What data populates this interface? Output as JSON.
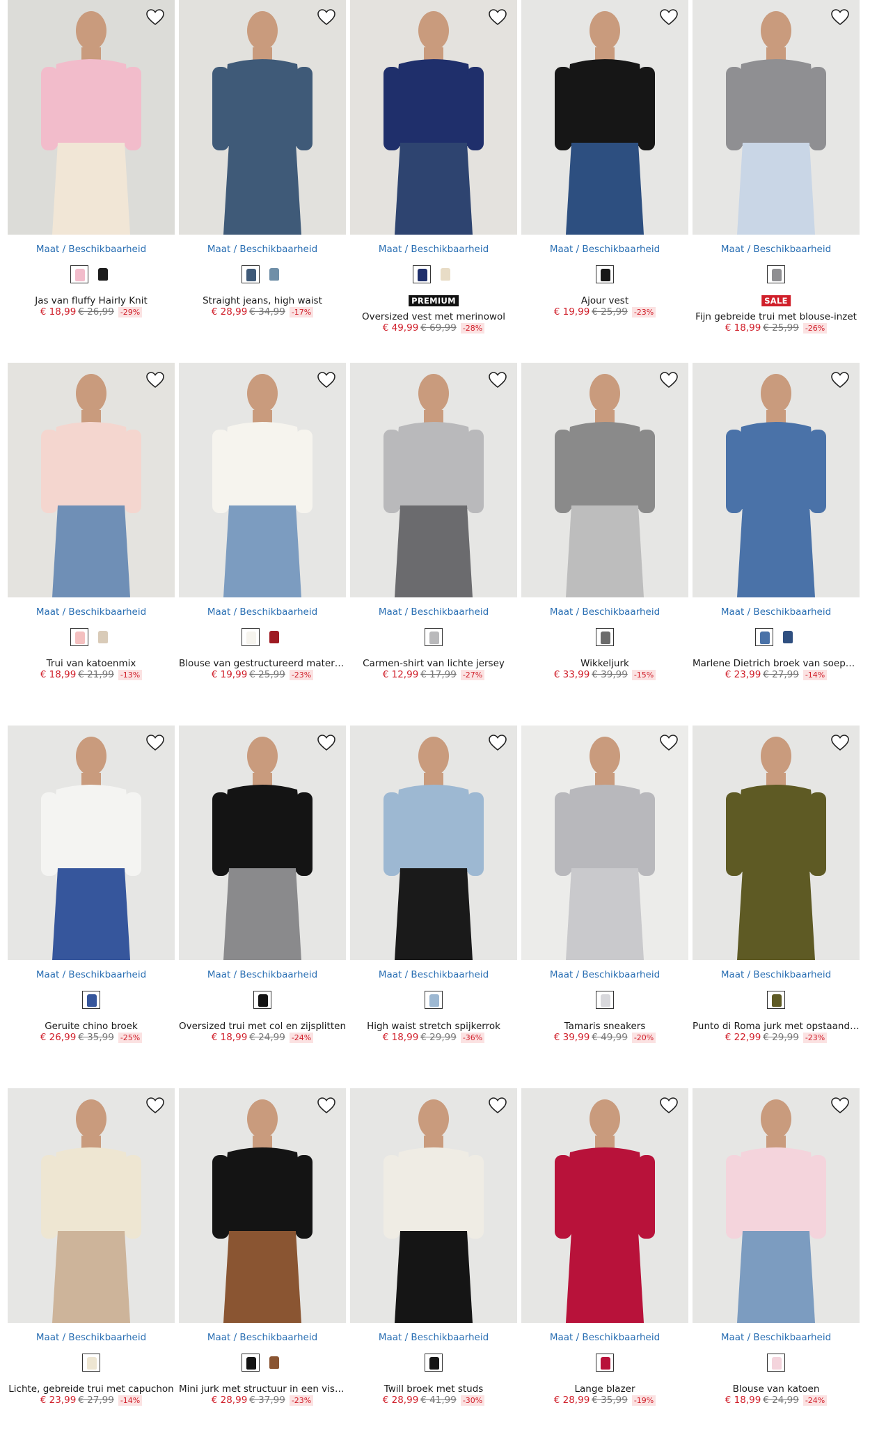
{
  "listing": {
    "size_link_label": "Maat / Beschikbaarheid",
    "products": [
      {
        "name": "Jas van fluffy Hairly Knit",
        "price": "€ 18,99",
        "old_price": "€ 26,99",
        "discount": "-29%",
        "badge": "",
        "bg": "#dcdcd8",
        "garment": "#f2bccb",
        "lower": "#f1e6d6",
        "swatches": [
          "#f2bccb",
          "#1c1c1c"
        ]
      },
      {
        "name": "Straight jeans, high waist",
        "price": "€ 28,99",
        "old_price": "€ 34,99",
        "discount": "-17%",
        "badge": "",
        "bg": "#e2e1dd",
        "garment": "#3f5a78",
        "lower": "#3f5a78",
        "swatches": [
          "#3f5a78",
          "#6f8fa8"
        ]
      },
      {
        "name": "Oversized vest met merinowol",
        "price": "€ 49,99",
        "old_price": "€ 69,99",
        "discount": "-28%",
        "badge": "PREMIUM",
        "bg": "#e4e2de",
        "garment": "#1f2f6b",
        "lower": "#2e4470",
        "swatches": [
          "#1f2f6b",
          "#e8dcc6"
        ]
      },
      {
        "name": "Ajour vest",
        "price": "€ 19,99",
        "old_price": "€ 25,99",
        "discount": "-23%",
        "badge": "",
        "bg": "#e6e6e4",
        "garment": "#161616",
        "lower": "#2d4f80",
        "swatches": [
          "#161616"
        ]
      },
      {
        "name": "Fijn gebreide trui met blouse-inzet",
        "price": "€ 18,99",
        "old_price": "€ 25,99",
        "discount": "-26%",
        "badge": "SALE",
        "bg": "#e6e6e4",
        "garment": "#8f8f92",
        "lower": "#c9d6e6",
        "swatches": [
          "#8f8f92"
        ]
      },
      {
        "name": "Trui van katoenmix",
        "price": "€ 18,99",
        "old_price": "€ 21,99",
        "discount": "-13%",
        "badge": "",
        "bg": "#e4e3df",
        "garment": "#f4d6cf",
        "lower": "#6f8fb6",
        "swatches": [
          "#f4c0c0",
          "#d9cbb8"
        ]
      },
      {
        "name": "Blouse van gestructureerd materiaal",
        "price": "€ 19,99",
        "old_price": "€ 25,99",
        "discount": "-23%",
        "badge": "",
        "bg": "#e6e6e4",
        "garment": "#f6f4ee",
        "lower": "#7c9cc0",
        "swatches": [
          "#f6f4ee",
          "#9e1a22"
        ]
      },
      {
        "name": "Carmen-shirt van lichte jersey",
        "price": "€ 12,99",
        "old_price": "€ 17,99",
        "discount": "-27%",
        "badge": "",
        "bg": "#e6e6e4",
        "garment": "#b9b9bb",
        "lower": "#6b6b6e",
        "swatches": [
          "#b9b9bb"
        ]
      },
      {
        "name": "Wikkeljurk",
        "price": "€ 33,99",
        "old_price": "€ 39,99",
        "discount": "-15%",
        "badge": "",
        "bg": "#e6e6e4",
        "garment": "#8a8a8a",
        "lower": "#bdbdbd",
        "swatches": [
          "#6b6b6b"
        ]
      },
      {
        "name": "Marlene Dietrich broek van soepelvallend materiaal",
        "price": "€ 23,99",
        "old_price": "€ 27,99",
        "discount": "-14%",
        "badge": "",
        "bg": "#e6e6e4",
        "garment": "#4a72a8",
        "lower": "#4a72a8",
        "swatches": [
          "#4a72a8",
          "#2f4f80"
        ]
      },
      {
        "name": "Geruite chino broek",
        "price": "€ 26,99",
        "old_price": "€ 35,99",
        "discount": "-25%",
        "badge": "",
        "bg": "#e6e6e4",
        "garment": "#f4f4f2",
        "lower": "#36569c",
        "swatches": [
          "#36569c"
        ]
      },
      {
        "name": "Oversized trui met col en zijsplitten",
        "price": "€ 18,99",
        "old_price": "€ 24,99",
        "discount": "-24%",
        "badge": "",
        "bg": "#e6e6e4",
        "garment": "#141414",
        "lower": "#8a8a8c",
        "swatches": [
          "#141414"
        ]
      },
      {
        "name": "High waist stretch spijkerrok",
        "price": "€ 18,99",
        "old_price": "€ 29,99",
        "discount": "-36%",
        "badge": "",
        "bg": "#e6e6e4",
        "garment": "#9db8d2",
        "lower": "#1a1a1a",
        "swatches": [
          "#9db8d2"
        ]
      },
      {
        "name": "Tamaris sneakers",
        "price": "€ 39,99",
        "old_price": "€ 49,99",
        "discount": "-20%",
        "badge": "",
        "bg": "#ececea",
        "garment": "#b8b8bc",
        "lower": "#c9c9cc",
        "swatches": [
          "#d8d8dc"
        ]
      },
      {
        "name": "Punto di Roma jurk met opstaande kraag",
        "price": "€ 22,99",
        "old_price": "€ 29,99",
        "discount": "-23%",
        "badge": "",
        "bg": "#e6e6e4",
        "garment": "#5e5a24",
        "lower": "#5e5a24",
        "swatches": [
          "#5e5a24"
        ]
      },
      {
        "name": "Lichte, gebreide trui met capuchon",
        "price": "€ 23,99",
        "old_price": "€ 27,99",
        "discount": "-14%",
        "badge": "",
        "bg": "#e6e6e4",
        "garment": "#eee6d2",
        "lower": "#cdb49a",
        "swatches": [
          "#eee6d2"
        ]
      },
      {
        "name": "Mini jurk met structuur in een viscose-look",
        "price": "€ 28,99",
        "old_price": "€ 37,99",
        "discount": "-23%",
        "badge": "",
        "bg": "#e6e6e4",
        "garment": "#141414",
        "lower": "#8a5532",
        "swatches": [
          "#141414",
          "#8a5532"
        ]
      },
      {
        "name": "Twill broek met studs",
        "price": "€ 28,99",
        "old_price": "€ 41,99",
        "discount": "-30%",
        "badge": "",
        "bg": "#e6e6e4",
        "garment": "#efece4",
        "lower": "#151515",
        "swatches": [
          "#151515"
        ]
      },
      {
        "name": "Lange blazer",
        "price": "€ 28,99",
        "old_price": "€ 35,99",
        "discount": "-19%",
        "badge": "",
        "bg": "#e6e6e4",
        "garment": "#b8123a",
        "lower": "#b8123a",
        "swatches": [
          "#b8123a"
        ]
      },
      {
        "name": "Blouse van katoen",
        "price": "€ 18,99",
        "old_price": "€ 24,99",
        "discount": "-24%",
        "badge": "",
        "bg": "#e6e6e4",
        "garment": "#f4d4dc",
        "lower": "#7c9cc0",
        "swatches": [
          "#f4d4dc"
        ]
      }
    ]
  }
}
